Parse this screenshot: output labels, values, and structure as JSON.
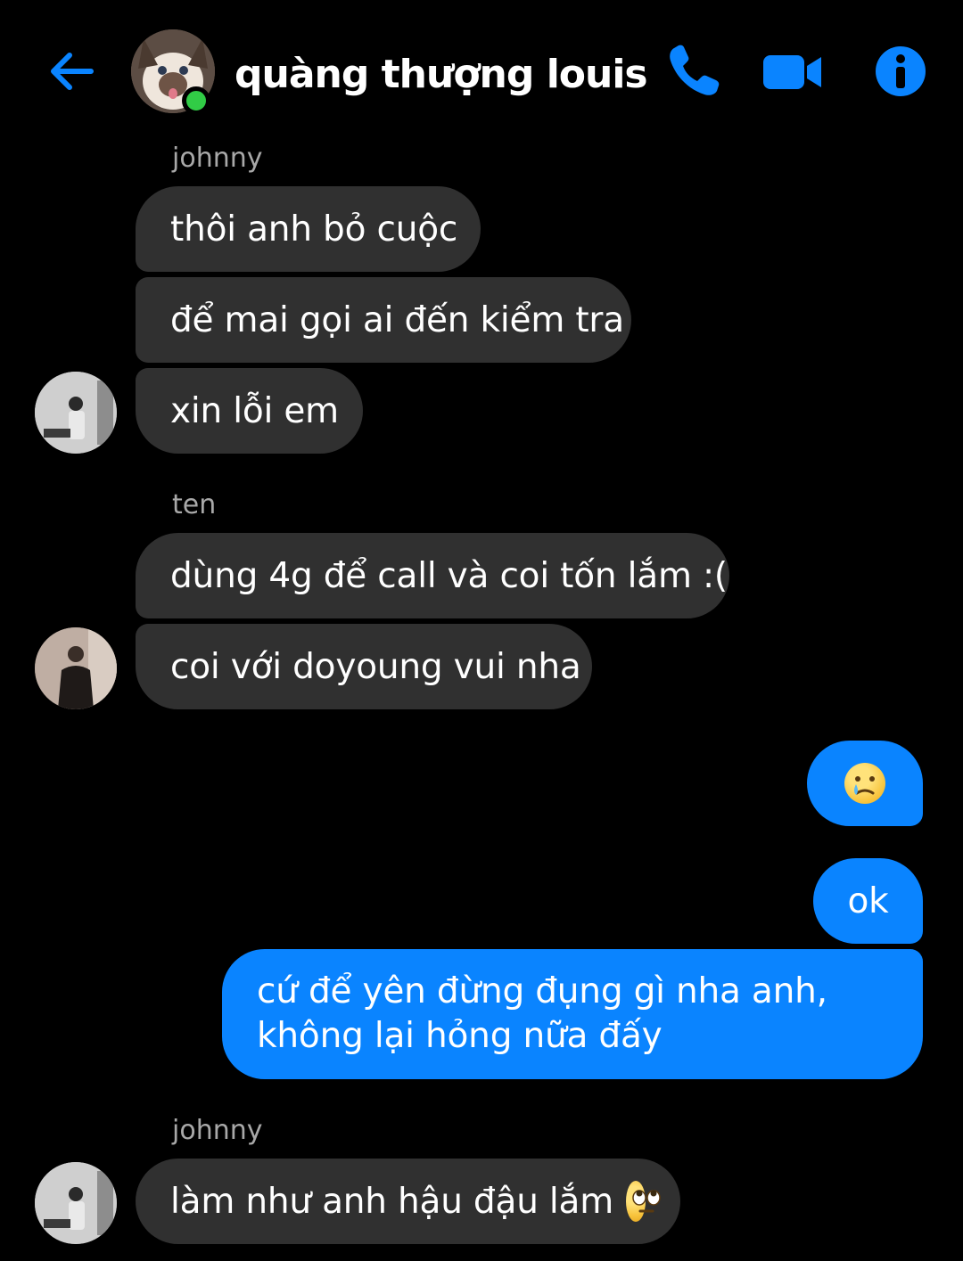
{
  "header": {
    "title": "quàng thượng louis",
    "icons": [
      "back-arrow-icon",
      "phone-icon",
      "video-camera-icon",
      "info-icon"
    ],
    "accent_color": "#0a84ff",
    "online_color": "#31cc46"
  },
  "messages": {
    "group1": {
      "sender": "johnny",
      "m1": "thôi anh bỏ cuộc",
      "m2": "để mai gọi ai đến kiểm tra",
      "m3": "xin lỗi em"
    },
    "group2": {
      "sender": "ten",
      "m1": "dùng 4g để call và coi tốn lắm :(",
      "m2": "coi với doyoung vui nha"
    },
    "outgoing": {
      "m1_emoji": "crying-face-emoji",
      "m2": "ok",
      "m3_line1": "cứ để yên đừng đụng gì nha anh,",
      "m3_line2": "không lại hỏng nữa đấy"
    },
    "group3": {
      "sender": "johnny",
      "m1": "làm như anh hậu đậu lắm",
      "m1_emoji": "eye-roll-emoji"
    }
  },
  "colors": {
    "incoming_bubble": "#303030",
    "outgoing_bubble": "#0a84ff",
    "background": "#000000"
  }
}
